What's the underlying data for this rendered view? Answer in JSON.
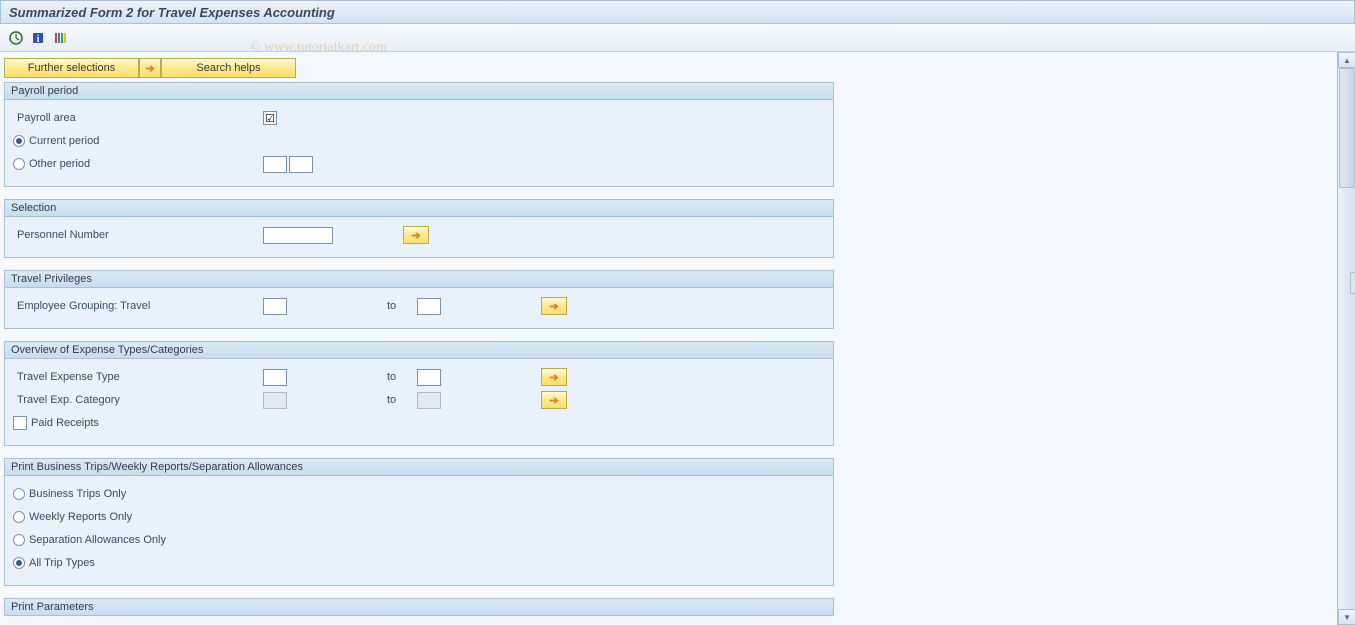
{
  "title": "Summarized Form 2 for Travel Expenses Accounting",
  "watermark": "© www.tutorialkart.com",
  "buttons": {
    "further_selections": "Further selections",
    "search_helps": "Search helps"
  },
  "panels": {
    "payroll": {
      "title": "Payroll period",
      "area_label": "Payroll area",
      "current_label": "Current period",
      "other_label": "Other period"
    },
    "selection": {
      "title": "Selection",
      "pernr_label": "Personnel Number"
    },
    "privileges": {
      "title": "Travel Privileges",
      "grouping_label": "Employee Grouping: Travel",
      "to": "to"
    },
    "overview": {
      "title": "Overview of Expense Types/Categories",
      "type_label": "Travel Expense Type",
      "cat_label": "Travel Exp. Category",
      "paid_label": "Paid Receipts",
      "to": "to"
    },
    "print_trips": {
      "title": "Print Business Trips/Weekly Reports/Separation Allowances",
      "biz_only": "Business Trips Only",
      "weekly_only": "Weekly Reports Only",
      "sep_only": "Separation Allowances Only",
      "all_types": "All Trip Types"
    },
    "print_params": {
      "title": "Print Parameters"
    }
  }
}
